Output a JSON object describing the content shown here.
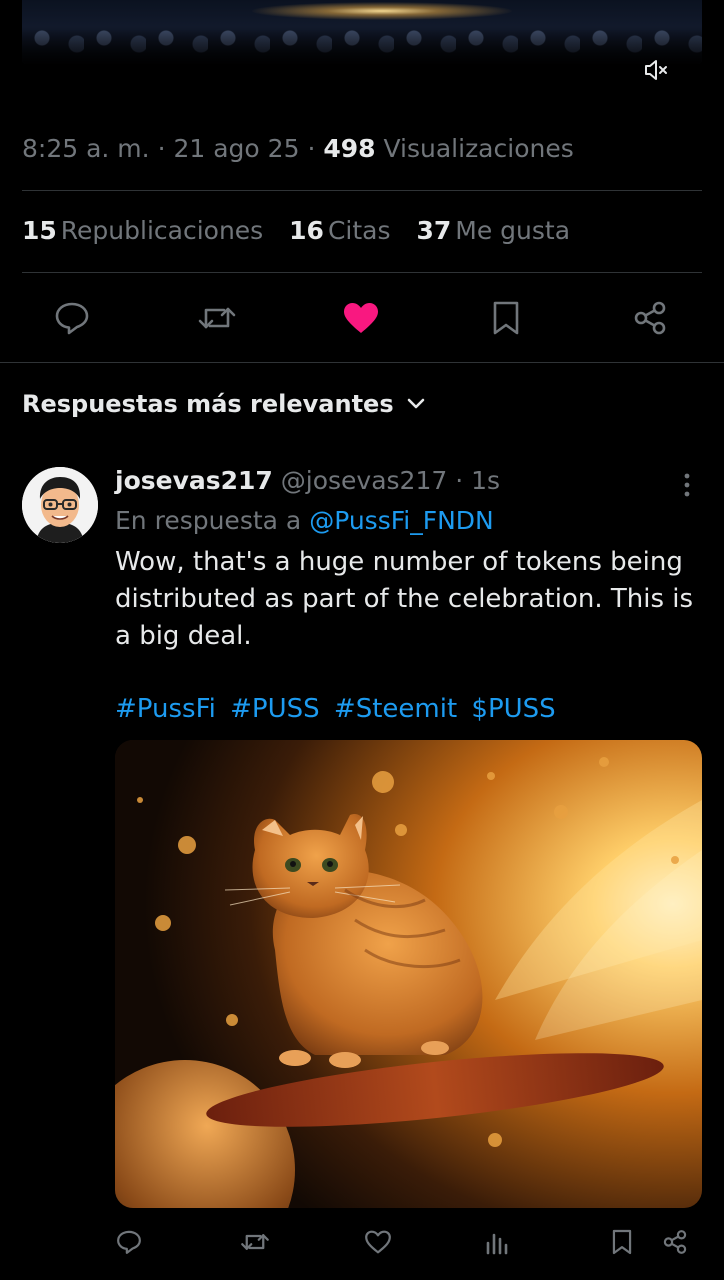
{
  "media_top": {
    "description_icon": "crowd-stage-video",
    "mute_icon": "speaker-muted-icon"
  },
  "tweet_meta": {
    "time": "8:25 a. m.",
    "separator": "·",
    "date": "21 ago 25",
    "views_count": "498",
    "views_label": "Visualizaciones"
  },
  "tweet_stats": {
    "reposts_count": "15",
    "reposts_label": "Republicaciones",
    "quotes_count": "16",
    "quotes_label": "Citas",
    "likes_count": "37",
    "likes_label": "Me gusta"
  },
  "actions": [
    {
      "icon": "reply-icon"
    },
    {
      "icon": "repost-icon"
    },
    {
      "icon": "heart-filled-icon",
      "active": true,
      "color": "#f91880"
    },
    {
      "icon": "bookmark-icon"
    },
    {
      "icon": "share-icon"
    }
  ],
  "replies_sort": {
    "label": "Respuestas más relevantes",
    "icon": "chevron-down-icon"
  },
  "reply": {
    "display_name": "josevas217",
    "handle": "@josevas217",
    "time": "1s",
    "reply_prefix": "En respuesta a",
    "reply_mention": "@PussFi_FNDN",
    "text": "Wow, that's a huge number of tokens being distributed as part of the celebration. This is a big deal.",
    "hashtags": [
      "#PussFi",
      "#PUSS",
      "#Steemit",
      "$PUSS"
    ],
    "media_icon": "cat-surfing-space-image"
  },
  "colors": {
    "background": "#000000",
    "text": "#e7e9ea",
    "muted": "#71767b",
    "link": "#1d9bf0",
    "like": "#f91880",
    "divider": "#2f3336"
  }
}
